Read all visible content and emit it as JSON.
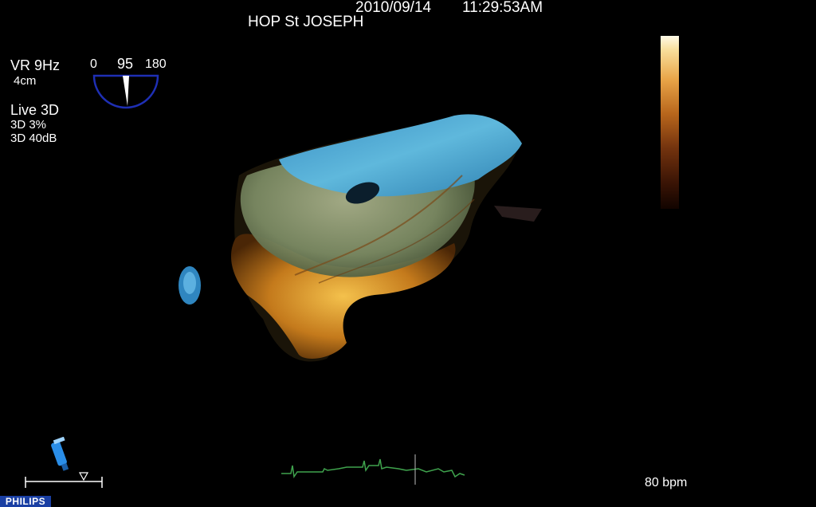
{
  "header": {
    "date": "2010/09/14",
    "time": "11:29:53AM",
    "hospital": "HOP St JOSEPH"
  },
  "acquisition": {
    "volume_rate": "VR 9Hz",
    "depth": "4cm",
    "mode": "Live 3D",
    "percent": "3D 3%",
    "gain": "3D 40dB"
  },
  "angle_gauge": {
    "min_label": "0",
    "value_label": "95",
    "max_label": "180",
    "angle_deg": 95,
    "color": "#1e2fb4"
  },
  "color_scale": {
    "top_color": "#fffbe8",
    "mid_color": "#e9a548",
    "bottom_color": "#120400"
  },
  "ecg": {
    "color": "#3fa34d",
    "heart_rate": "80 bpm"
  },
  "image_icons": [
    "volume-render-image",
    "probe-icon",
    "depth-scale",
    "ecg-trace-icon"
  ],
  "brand": "PHILIPS"
}
